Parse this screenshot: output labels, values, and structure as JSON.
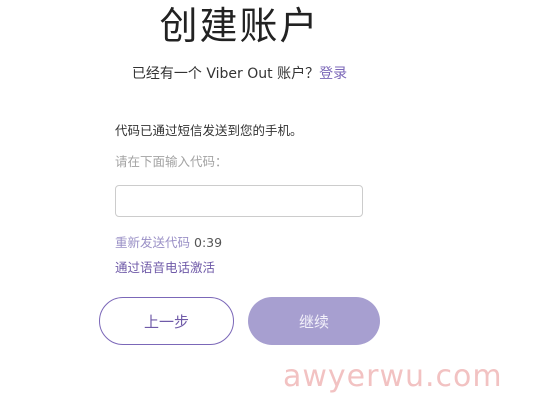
{
  "header": {
    "title": "创建账户",
    "have_account_text": "已经有一个 Viber Out 账户？",
    "login_link": "登录"
  },
  "form": {
    "sent_message": "代码已通过短信发送到您的手机。",
    "code_label": "请在下面输入代码：",
    "code_value": "",
    "resend_link": "重新发送代码",
    "resend_timer": "0:39",
    "voice_link": "通过语音电话激活"
  },
  "buttons": {
    "back_label": "上一步",
    "continue_label": "继续"
  },
  "watermark": {
    "text": "awyerwu.com"
  },
  "colors": {
    "accent": "#7b67b8",
    "continue_disabled": "#a79fd0",
    "link_muted": "#9a90c6"
  }
}
